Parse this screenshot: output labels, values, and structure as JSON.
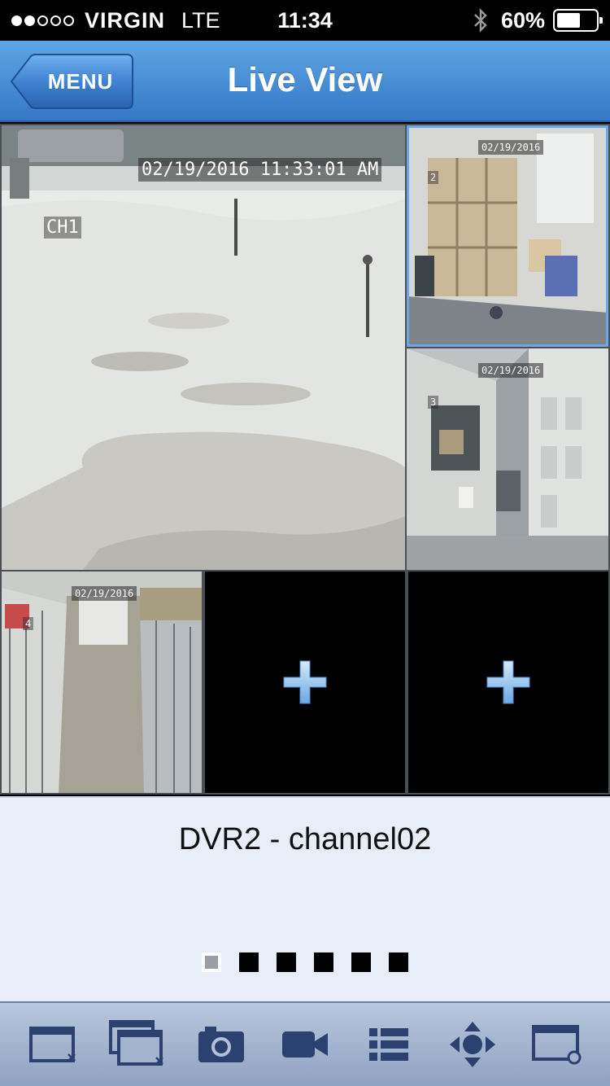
{
  "status_bar": {
    "carrier": "VIRGIN",
    "network": "LTE",
    "time": "11:34",
    "battery_percent": "60%",
    "battery_level": 0.6,
    "signal_bars_filled": 2,
    "signal_bars_total": 5
  },
  "nav": {
    "menu_label": "MENU",
    "title": "Live View"
  },
  "feeds": {
    "main": {
      "timestamp": "02/19/2016 11:33:01 AM",
      "channel": "CH1"
    },
    "top_right": {
      "timestamp": "02/19/2016",
      "channel": "2"
    },
    "mid_right": {
      "timestamp": "02/19/2016",
      "channel": "3"
    },
    "bottom_left": {
      "timestamp": "02/19/2016",
      "channel": "4"
    }
  },
  "empty_slots": [
    {
      "icon": "plus-icon"
    },
    {
      "icon": "plus-icon"
    }
  ],
  "info": {
    "channel_name": "DVR2 - channel02",
    "page_count": 6,
    "active_page": 0
  },
  "toolbar": {
    "icons": [
      "close-channel-icon",
      "close-all-icon",
      "snapshot-camera-icon",
      "record-video-icon",
      "device-list-icon",
      "ptz-control-icon",
      "settings-window-icon"
    ]
  },
  "colors": {
    "nav_blue": "#4a90d9",
    "toolbar_icon": "#2b4270",
    "plus": "#8ec0ee"
  }
}
